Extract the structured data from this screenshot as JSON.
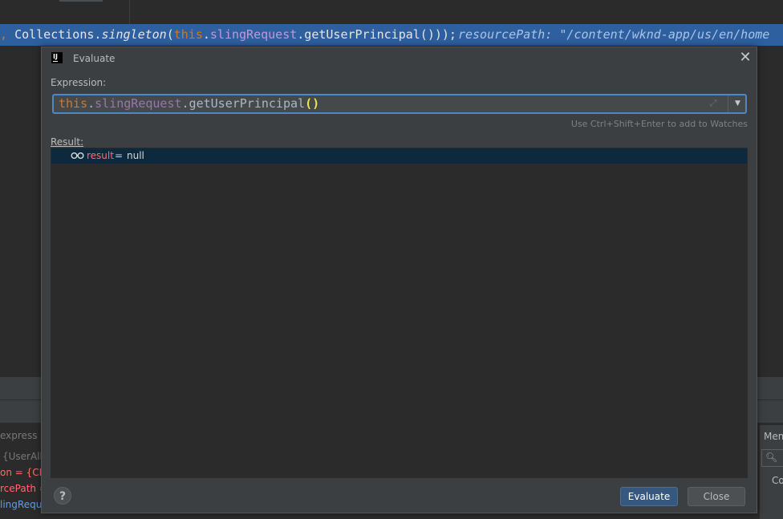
{
  "editor": {
    "code_tokens": [
      {
        "text": ", ",
        "cls": "c-punc"
      },
      {
        "text": "Collections.",
        "cls": "c-plain"
      },
      {
        "text": "singleton",
        "cls": "c-italic"
      },
      {
        "text": "(",
        "cls": "c-plain"
      },
      {
        "text": "this",
        "cls": "c-kw"
      },
      {
        "text": ".",
        "cls": "c-plain"
      },
      {
        "text": "slingRequest",
        "cls": "c-field"
      },
      {
        "text": ".getUserPrincipal()));",
        "cls": "c-plain"
      }
    ],
    "inline_hint": "resourcePath: \"/content/wknd-app/us/en/home",
    "side_texts": [
      {
        "text": "express",
        "color": "#787878"
      },
      {
        "text": "{UserAllc",
        "color": "#787878"
      },
      {
        "text": "on = {CRX",
        "color": "#ff6b68"
      },
      {
        "text": "rcePath =",
        "color": "#ff6b68"
      },
      {
        "text": "lingReque",
        "color": "#5f9ee6"
      }
    ],
    "right_panel": {
      "tab": "Mem",
      "item": "Co"
    }
  },
  "dialog": {
    "title": "Evaluate",
    "expression_label": "Expression:",
    "expression": {
      "this": "this",
      "dot1": ".",
      "field": "slingRequest",
      "method": ".getUserPrincipal",
      "parens": "()"
    },
    "hint": "Use Ctrl+Shift+Enter to add to Watches",
    "result_label": "Result:",
    "result": {
      "name": "result",
      "equals": "=",
      "value": "null"
    },
    "buttons": {
      "help": "?",
      "evaluate": "Evaluate",
      "close": "Close"
    }
  },
  "colors": {
    "keyword": "#cc7832",
    "field": "#9876aa",
    "selection": "#2e5f9e",
    "accent": "#4a88c7"
  },
  "icons": [
    "app-icon",
    "close-icon",
    "expand-icon",
    "dropdown-icon",
    "watch-glasses-icon",
    "help-icon",
    "search-icon"
  ]
}
